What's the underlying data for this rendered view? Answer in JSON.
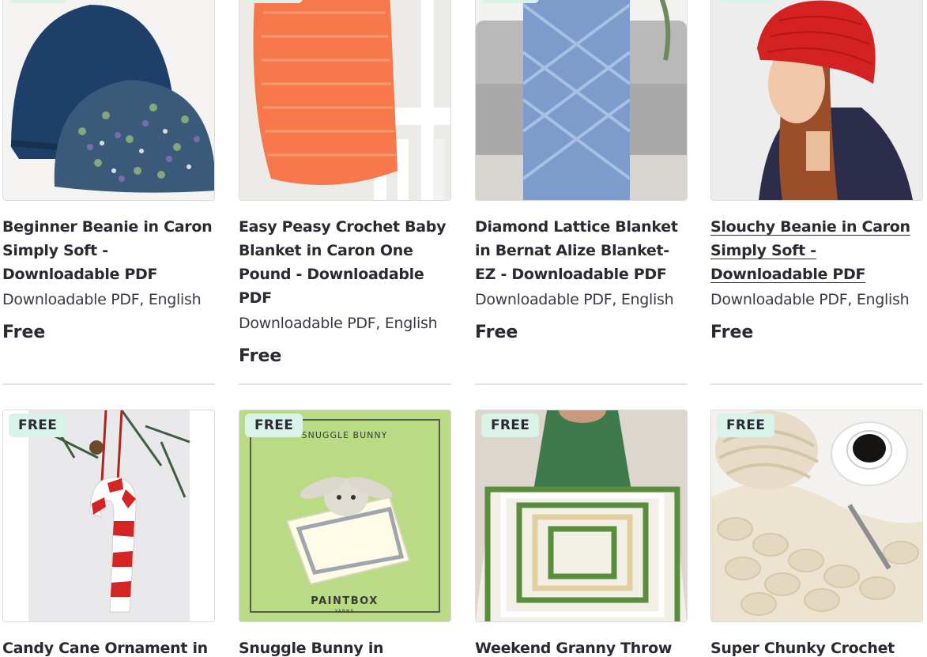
{
  "badge_label": "FREE",
  "cards_row1": [
    {
      "title": "Beginner Beanie in Caron Simply Soft - Downloadable PDF",
      "format": "Downloadable PDF, English",
      "price": "Free",
      "image": "blue-beanies"
    },
    {
      "title": "Easy Peasy Crochet Baby Blanket in Caron One Pound - Downloadable PDF",
      "format": "Downloadable PDF, English",
      "price": "Free",
      "image": "orange-blanket-chair"
    },
    {
      "title": "Diamond Lattice Blanket in Bernat Alize Blanket-EZ - Downloadable PDF",
      "format": "Downloadable PDF, English",
      "price": "Free",
      "image": "blue-lattice-blanket-sofa"
    },
    {
      "title": "Slouchy Beanie in Caron Simply Soft - Downloadable PDF",
      "format": "Downloadable PDF, English",
      "price": "Free",
      "image": "red-slouchy-beanie-woman"
    }
  ],
  "cards_row2": [
    {
      "title": "Candy Cane Ornament in",
      "image": "candy-cane-ornament"
    },
    {
      "title": "Snuggle Bunny in Paintbox",
      "image": "snuggle-bunny-lovey",
      "image_text": {
        "top": "SNUGGLE BUNNY",
        "brand": "PAINTBOX",
        "brand_sub": "YARNS"
      }
    },
    {
      "title": "Weekend Granny Throw in",
      "image": "green-granny-throw"
    },
    {
      "title": "Super Chunky Crochet Throw",
      "image": "chunky-crochet-throw-coffee"
    }
  ],
  "colors": {
    "badge_bg": "#d9f3e8",
    "text": "#2a2a33",
    "divider": "#e2e2e2"
  }
}
